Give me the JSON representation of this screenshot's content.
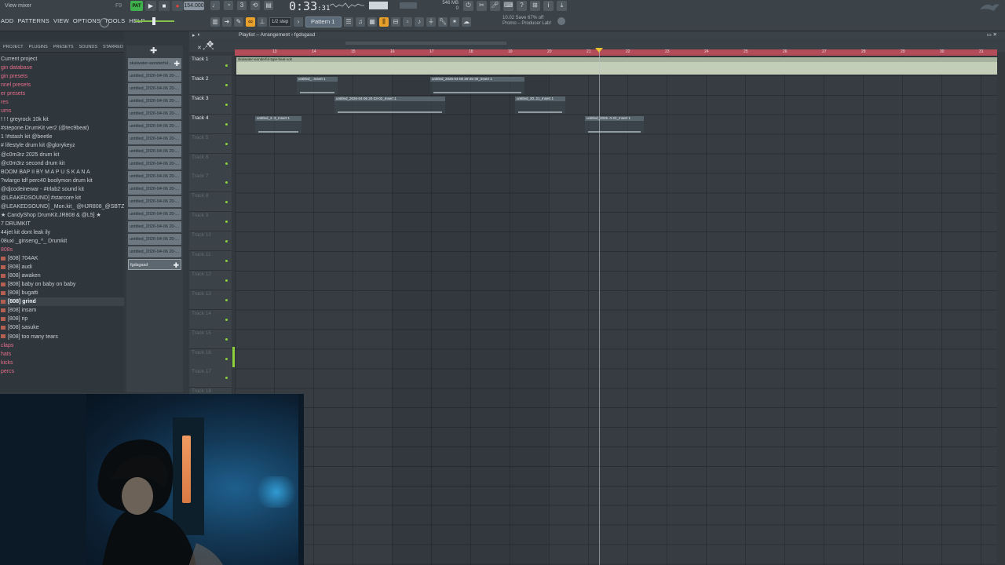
{
  "topbar": {
    "hint": "View mixer",
    "hint_key": "F9",
    "menu": [
      "ADD",
      "PATTERNS",
      "VIEW",
      "OPTIONS",
      "TOOLS",
      "HELP"
    ],
    "pat_label": "PAT",
    "tempo": "154.000",
    "time_main": "0:33",
    "time_sub": ":31",
    "cpu_top": "546 MB",
    "cpu_bottom": "0",
    "step": "1/2 step",
    "pattern": "Pattern 1",
    "news_line1": "10.02  Save 67% off",
    "news_line2": "Promo – Producer Lab!"
  },
  "browser": {
    "tabs": [
      "PROJECT",
      "PLUGINS",
      "PRESETS",
      "SOUNDS",
      "STARRED"
    ],
    "items": [
      {
        "label": "Current project",
        "type": "plain"
      },
      {
        "label": "gin database",
        "type": "folder"
      },
      {
        "label": "gin presets",
        "type": "folder"
      },
      {
        "label": "nnel presets",
        "type": "folder"
      },
      {
        "label": "er presets",
        "type": "folder"
      },
      {
        "label": "res",
        "type": "folder"
      },
      {
        "label": "ums",
        "type": "folder"
      },
      {
        "label": "! ! ! greyrock 10k kit",
        "type": "plain"
      },
      {
        "label": "#stepone.DrumKit ver2 (@tec9beat)",
        "type": "plain"
      },
      {
        "label": "1 !#stash kit @beetle",
        "type": "plain"
      },
      {
        "label": "# lifestyle drum kit @glorykeyz",
        "type": "plain"
      },
      {
        "label": "@c0m3rz 2025 drum kit",
        "type": "plain"
      },
      {
        "label": "@c0m3rz second drum kit",
        "type": "plain"
      },
      {
        "label": "BOOM BAP II BY M A P U S K A N A",
        "type": "plain"
      },
      {
        "label": "?wlargo tdf perc40 boolymon drum kit",
        "type": "plain"
      },
      {
        "label": "@djcodeinewar - #trlab2 sound kit",
        "type": "plain"
      },
      {
        "label": "@LEAKEDSOUND] #starcore kit",
        "type": "plain"
      },
      {
        "label": "@LEAKEDSOUND] _Mon.kit_ @HJR808_@SBTZ",
        "type": "plain"
      },
      {
        "label": "★ CandyShop DrumKit.JR808 & @L5] ★",
        "type": "plain"
      },
      {
        "label": "7 DRUMKIT",
        "type": "plain"
      },
      {
        "label": "44jet kit dont leak ily",
        "type": "plain"
      },
      {
        "label": "08uxi _ginseng_^_ Drumkit",
        "type": "plain"
      },
      {
        "label": "808s",
        "type": "folder"
      },
      {
        "label": "[808] 704AK",
        "type": "file"
      },
      {
        "label": "[808] audi",
        "type": "file"
      },
      {
        "label": "[808] awaken",
        "type": "file"
      },
      {
        "label": "[808] baby on baby on baby",
        "type": "file"
      },
      {
        "label": "[808] bugatti",
        "type": "file"
      },
      {
        "label": "[808] grind",
        "type": "selected"
      },
      {
        "label": "[808] insam",
        "type": "file"
      },
      {
        "label": "[808] rip",
        "type": "file"
      },
      {
        "label": "[808] sasuke",
        "type": "file"
      },
      {
        "label": "[808] too many tears",
        "type": "file"
      },
      {
        "label": "claps",
        "type": "folder"
      },
      {
        "label": "hats",
        "type": "folder"
      },
      {
        "label": "kicks",
        "type": "folder"
      },
      {
        "label": "percs",
        "type": "folder"
      }
    ]
  },
  "cliplist": {
    "items": [
      "skaiwater-wonderful...",
      "untitled_2026-04-06 20-...",
      "untitled_2026-04-06 20-...",
      "untitled_2026-04-06 20-...",
      "untitled_2026-04-06 20-...",
      "untitled_2026-04-06 20-...",
      "untitled_2026-04-06 20-...",
      "untitled_2026-04-06 20-...",
      "untitled_2026-04-06 20-...",
      "untitled_2026-04-06 20-...",
      "untitled_2026-04-06 20-...",
      "untitled_2026-04-06 20-...",
      "untitled_2026-04-06 20-...",
      "untitled_2026-04-06 20-...",
      "untitled_2026-04-06 20-...",
      "untitled_2026-04-06 20-..."
    ],
    "active": "fgdsgasd"
  },
  "playlist": {
    "title": "Playlist – Arrangement › fgdsgasd",
    "tracks": [
      "Track 1",
      "Track 2",
      "Track 3",
      "Track 4",
      "Track 5",
      "Track 6",
      "Track 7",
      "Track 8",
      "Track 9",
      "Track 10",
      "Track 11",
      "Track 12",
      "Track 13",
      "Track 14",
      "Track 15",
      "Track 16",
      "Track 17",
      "Track 18"
    ],
    "bars": [
      "13",
      "14",
      "15",
      "16",
      "17",
      "18",
      "19",
      "20",
      "21",
      "22",
      "23",
      "24",
      "25",
      "26",
      "27",
      "28",
      "29",
      "30",
      "31",
      "32"
    ],
    "clips": {
      "t1": "skaiwater-wonderful-type-beat-ook",
      "t2a": "untitled_..Insert 1",
      "t2b": "untitled_2026-04-06 20-25-30_Insert 1",
      "t3a": "untitled_2026-04-06 20-23-02_Insert 1",
      "t3b": "untitled_20..21_Insert 1",
      "t4a": "untitled_2..3_Insert 1",
      "t4b": "untitled_2026..0-22_Insert 1"
    }
  }
}
